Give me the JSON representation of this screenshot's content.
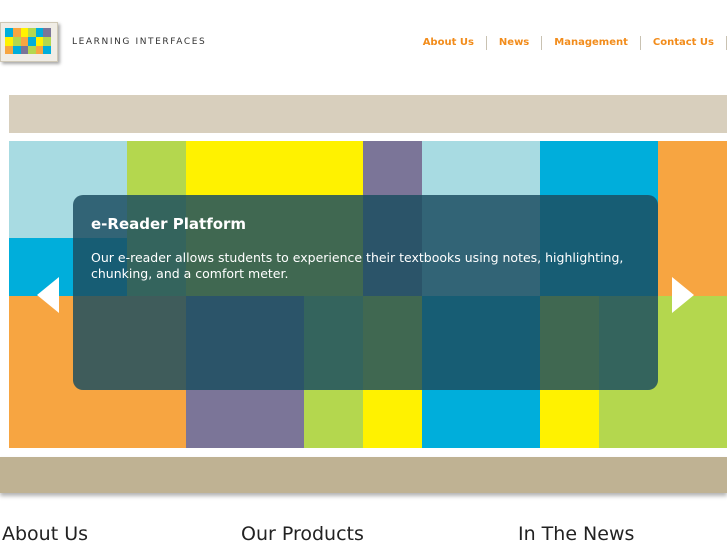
{
  "brand": {
    "name": "LEARNING INTERFACES"
  },
  "nav": [
    {
      "label": "About Us"
    },
    {
      "label": "News"
    },
    {
      "label": "Management"
    },
    {
      "label": "Contact Us"
    }
  ],
  "slider": {
    "title": "e-Reader Platform",
    "description": "Our e-reader allows students to experience their textbooks using notes, highlighting, chunking, and a comfort meter.",
    "prev_icon": "arrow-left-icon",
    "next_icon": "arrow-right-icon"
  },
  "sections": [
    {
      "label": "About Us"
    },
    {
      "label": "Our Products"
    },
    {
      "label": "In The News"
    }
  ],
  "colors": {
    "accent": "#f28c1b",
    "band_top": "#d8cfbd",
    "band_bottom": "#bfb293",
    "caption": "#1c4e60"
  }
}
